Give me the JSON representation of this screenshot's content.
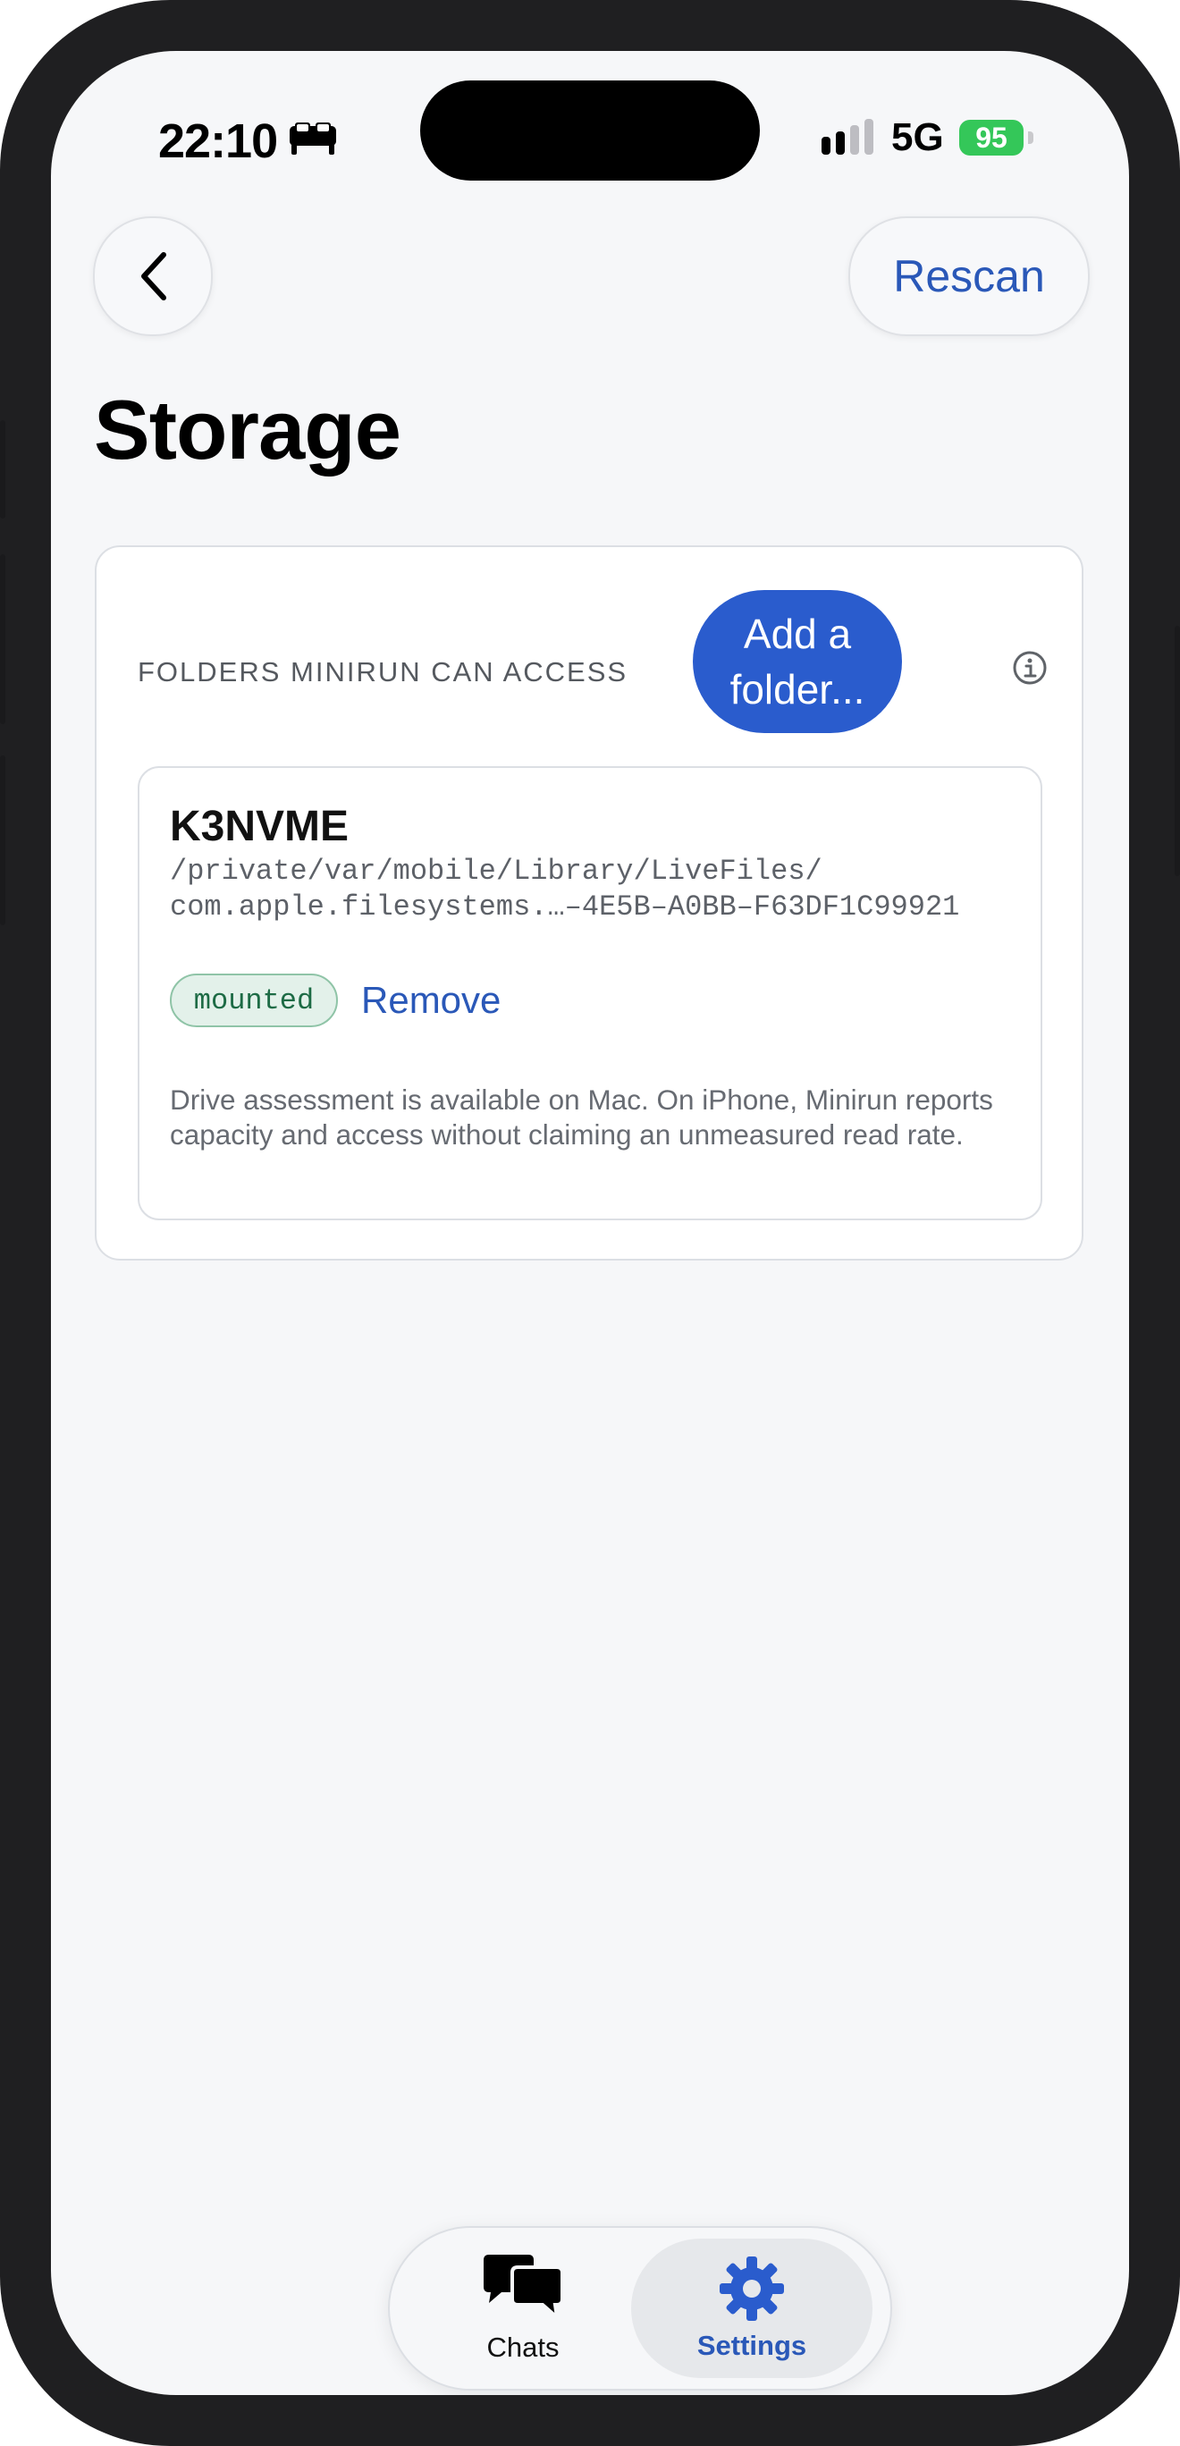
{
  "status_bar": {
    "time": "22:10",
    "network": "5G",
    "battery_level": "95",
    "icons": [
      "bed-icon",
      "cellular-signal-icon",
      "battery-charging-icon"
    ]
  },
  "nav": {
    "back_icon": "chevron-left-icon",
    "rescan_label": "Rescan"
  },
  "page": {
    "title": "Storage"
  },
  "folders_section": {
    "label": "FOLDERS MINIRUN CAN ACCESS",
    "add_button_label": "Add a folder...",
    "info_icon": "info-icon",
    "folders": [
      {
        "name": "K3NVME",
        "path_line1": "/private/var/mobile/Library/LiveFiles/",
        "path_line2": "com.apple.filesystems.…–4E5B–A0BB–F63DF1C99921",
        "status": "mounted",
        "remove_label": "Remove",
        "note": "Drive assessment is available on Mac. On iPhone, Minirun reports capacity and access without claiming an unmeasured read rate."
      }
    ]
  },
  "tabbar": {
    "tabs": [
      {
        "label": "Chats",
        "icon": "chat-bubbles-icon",
        "selected": false
      },
      {
        "label": "Settings",
        "icon": "gear-icon",
        "selected": true
      }
    ]
  },
  "colors": {
    "accent": "#2a58b8",
    "button_fill": "#2a5ccd",
    "battery": "#34c759",
    "badge_bg": "#e3f1ea",
    "badge_text": "#1d6b45"
  }
}
